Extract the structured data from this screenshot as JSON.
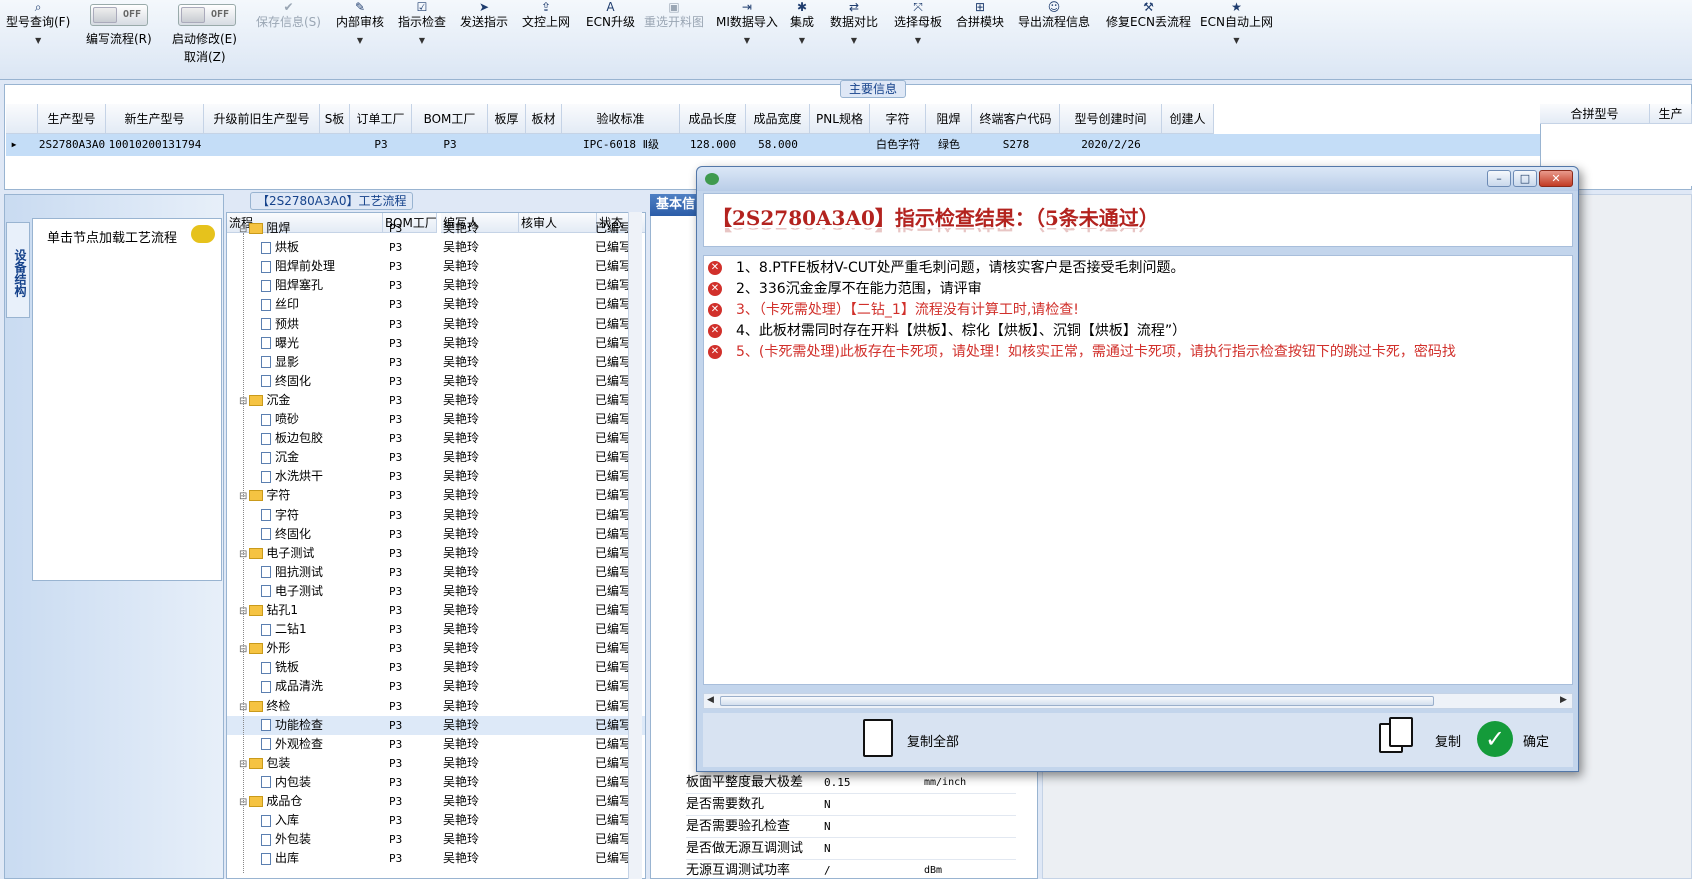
{
  "toolbar": {
    "items": [
      {
        "icon": "search-icon",
        "glyph": "⌕",
        "label": "型号查询(F)",
        "disabled": false,
        "dropdown": true
      },
      {
        "icon": "save-icon",
        "glyph": "✔",
        "label": "保存信息(S)",
        "disabled": true,
        "dropdown": false
      },
      {
        "icon": "review-icon",
        "glyph": "✎",
        "label": "内部审核",
        "disabled": false,
        "dropdown": true
      },
      {
        "icon": "check-icon",
        "glyph": "☑",
        "label": "指示检查",
        "disabled": false,
        "dropdown": true
      },
      {
        "icon": "send-icon",
        "glyph": "➤",
        "label": "发送指示",
        "disabled": false,
        "dropdown": false
      },
      {
        "icon": "upload-icon",
        "glyph": "⇪",
        "label": "文控上网",
        "disabled": false,
        "dropdown": false
      },
      {
        "icon": "ecn-upgrade-icon",
        "glyph": "A",
        "label": "ECN升级",
        "disabled": false,
        "dropdown": false
      },
      {
        "icon": "image-icon",
        "glyph": "▣",
        "label": "重选开料图",
        "disabled": true,
        "dropdown": false
      },
      {
        "icon": "import-icon",
        "glyph": "⇥",
        "label": "MI数据导入",
        "disabled": false,
        "dropdown": true
      },
      {
        "icon": "integrate-icon",
        "glyph": "✱",
        "label": "集成",
        "disabled": false,
        "dropdown": true
      },
      {
        "icon": "compare-icon",
        "glyph": "⇄",
        "label": "数据对比",
        "disabled": false,
        "dropdown": true
      },
      {
        "icon": "mother-board-icon",
        "glyph": "⤧",
        "label": "选择母板",
        "disabled": false,
        "dropdown": true
      },
      {
        "icon": "merge-icon",
        "glyph": "⊞",
        "label": "合拼模块",
        "disabled": false,
        "dropdown": false
      },
      {
        "icon": "export-icon",
        "glyph": "☺",
        "label": "导出流程信息",
        "disabled": false,
        "dropdown": false
      },
      {
        "icon": "repair-icon",
        "glyph": "⚒",
        "label": "修复ECN丢流程",
        "disabled": false,
        "dropdown": false
      },
      {
        "icon": "star-icon",
        "glyph": "★",
        "label": "ECN自动上网",
        "disabled": false,
        "dropdown": true
      }
    ],
    "toggle_off": "OFF",
    "write_flow_label": "编写流程(R)",
    "start_edit_label": "启动修改(E)",
    "cancel_label": "取消(Z)"
  },
  "main_info": {
    "title": "主要信息",
    "columns": [
      "生产型号",
      "新生产型号",
      "升级前旧生产型号",
      "S板",
      "订单工厂",
      "BOM工厂",
      "板厚",
      "板材",
      "验收标准",
      "成品长度",
      "成品宽度",
      "PNL规格",
      "字符",
      "阻焊",
      "终端客户代码",
      "型号创建时间",
      "创建人"
    ],
    "row": [
      "2S2780A3A0",
      "10010200131794",
      "",
      "",
      "P3",
      "P3",
      "",
      "",
      "IPC-6018 Ⅱ级",
      "128.000",
      "58.000",
      "",
      "白色字符",
      "绿色",
      "S278",
      "2020/2/26",
      ""
    ],
    "merge_columns": [
      "合拼型号",
      "生产"
    ]
  },
  "left_panel": {
    "tab": "设备结构",
    "hint": "单击节点加载工艺流程"
  },
  "process": {
    "title": "【2S2780A3A0】工艺流程",
    "columns": [
      "流程",
      "BOM工厂",
      "编写人",
      "核审人",
      "状态"
    ],
    "rows": [
      {
        "name": "阻焊",
        "folder": true,
        "level": 0,
        "bom": "P3",
        "writer": "吴艳玲",
        "status": "已编写"
      },
      {
        "name": "烘板",
        "folder": false,
        "level": 1,
        "bom": "P3",
        "writer": "吴艳玲",
        "status": "已编写"
      },
      {
        "name": "阻焊前处理",
        "folder": false,
        "level": 1,
        "bom": "P3",
        "writer": "吴艳玲",
        "status": "已编写"
      },
      {
        "name": "阻焊塞孔",
        "folder": false,
        "level": 1,
        "bom": "P3",
        "writer": "吴艳玲",
        "status": "已编写"
      },
      {
        "name": "丝印",
        "folder": false,
        "level": 1,
        "bom": "P3",
        "writer": "吴艳玲",
        "status": "已编写"
      },
      {
        "name": "预烘",
        "folder": false,
        "level": 1,
        "bom": "P3",
        "writer": "吴艳玲",
        "status": "已编写"
      },
      {
        "name": "曝光",
        "folder": false,
        "level": 1,
        "bom": "P3",
        "writer": "吴艳玲",
        "status": "已编写"
      },
      {
        "name": "显影",
        "folder": false,
        "level": 1,
        "bom": "P3",
        "writer": "吴艳玲",
        "status": "已编写"
      },
      {
        "name": "终固化",
        "folder": false,
        "level": 1,
        "bom": "P3",
        "writer": "吴艳玲",
        "status": "已编写"
      },
      {
        "name": "沉金",
        "folder": true,
        "level": 0,
        "bom": "P3",
        "writer": "吴艳玲",
        "status": "已编写"
      },
      {
        "name": "喷砂",
        "folder": false,
        "level": 1,
        "bom": "P3",
        "writer": "吴艳玲",
        "status": "已编写"
      },
      {
        "name": "板边包胶",
        "folder": false,
        "level": 1,
        "bom": "P3",
        "writer": "吴艳玲",
        "status": "已编写"
      },
      {
        "name": "沉金",
        "folder": false,
        "level": 1,
        "bom": "P3",
        "writer": "吴艳玲",
        "status": "已编写"
      },
      {
        "name": "水洗烘干",
        "folder": false,
        "level": 1,
        "bom": "P3",
        "writer": "吴艳玲",
        "status": "已编写"
      },
      {
        "name": "字符",
        "folder": true,
        "level": 0,
        "bom": "P3",
        "writer": "吴艳玲",
        "status": "已编写"
      },
      {
        "name": "字符",
        "folder": false,
        "level": 1,
        "bom": "P3",
        "writer": "吴艳玲",
        "status": "已编写"
      },
      {
        "name": "终固化",
        "folder": false,
        "level": 1,
        "bom": "P3",
        "writer": "吴艳玲",
        "status": "已编写"
      },
      {
        "name": "电子测试",
        "folder": true,
        "level": 0,
        "bom": "P3",
        "writer": "吴艳玲",
        "status": "已编写"
      },
      {
        "name": "阻抗测试",
        "folder": false,
        "level": 1,
        "bom": "P3",
        "writer": "吴艳玲",
        "status": "已编写"
      },
      {
        "name": "电子测试",
        "folder": false,
        "level": 1,
        "bom": "P3",
        "writer": "吴艳玲",
        "status": "已编写"
      },
      {
        "name": "钻孔1",
        "folder": true,
        "level": 0,
        "bom": "P3",
        "writer": "吴艳玲",
        "status": "已编写"
      },
      {
        "name": "二钻1",
        "folder": false,
        "level": 1,
        "bom": "P3",
        "writer": "吴艳玲",
        "status": "已编写"
      },
      {
        "name": "外形",
        "folder": true,
        "level": 0,
        "bom": "P3",
        "writer": "吴艳玲",
        "status": "已编写"
      },
      {
        "name": "铣板",
        "folder": false,
        "level": 1,
        "bom": "P3",
        "writer": "吴艳玲",
        "status": "已编写"
      },
      {
        "name": "成品清洗",
        "folder": false,
        "level": 1,
        "bom": "P3",
        "writer": "吴艳玲",
        "status": "已编写"
      },
      {
        "name": "终检",
        "folder": true,
        "level": 0,
        "bom": "P3",
        "writer": "吴艳玲",
        "status": "已编写"
      },
      {
        "name": "功能检查",
        "folder": false,
        "level": 1,
        "bom": "P3",
        "writer": "吴艳玲",
        "status": "已编写",
        "selected": true
      },
      {
        "name": "外观检查",
        "folder": false,
        "level": 1,
        "bom": "P3",
        "writer": "吴艳玲",
        "status": "已编写"
      },
      {
        "name": "包装",
        "folder": true,
        "level": 0,
        "bom": "P3",
        "writer": "吴艳玲",
        "status": "已编写"
      },
      {
        "name": "内包装",
        "folder": false,
        "level": 1,
        "bom": "P3",
        "writer": "吴艳玲",
        "status": "已编写"
      },
      {
        "name": "成品仓",
        "folder": true,
        "level": 0,
        "bom": "P3",
        "writer": "吴艳玲",
        "status": "已编写"
      },
      {
        "name": "入库",
        "folder": false,
        "level": 1,
        "bom": "P3",
        "writer": "吴艳玲",
        "status": "已编写"
      },
      {
        "name": "外包装",
        "folder": false,
        "level": 1,
        "bom": "P3",
        "writer": "吴艳玲",
        "status": "已编写"
      },
      {
        "name": "出库",
        "folder": false,
        "level": 1,
        "bom": "P3",
        "writer": "吴艳玲",
        "status": "已编写"
      }
    ]
  },
  "basic_panel": {
    "tab": "基本信",
    "rows": [
      {
        "key": "板面平整度最大极差",
        "value": "0.15",
        "unit": "mm/inch"
      },
      {
        "key": "是否需要数孔",
        "value": "N",
        "unit": ""
      },
      {
        "key": "是否需要验孔检查",
        "value": "N",
        "unit": ""
      },
      {
        "key": "是否做无源互调测试",
        "value": "N",
        "unit": ""
      },
      {
        "key": "无源互调测试功率",
        "value": "/",
        "unit": "dBm"
      }
    ]
  },
  "dialog": {
    "heading": "【2S2780A3A0】指示检查结果：（5条未通过）",
    "minimize": "–",
    "maximize": "□",
    "close": "✕",
    "issues": [
      {
        "text": "1、8.PTFE板材V-CUT处严重毛刺问题，请核实客户是否接受毛刺问题。",
        "red": false
      },
      {
        "text": "2、336沉金金厚不在能力范围，请评审",
        "red": false
      },
      {
        "text": "3、（卡死需处理）【二钻_1】流程没有计算工时,请检查!",
        "red": true
      },
      {
        "text": "4、此板材需同时存在开料【烘板】、棕化【烘板】、沉铜【烘板】流程”）",
        "red": false
      },
      {
        "text": "5、(卡死需处理)此板存在卡死项，请处理！如核实正常，需通过卡死项，请执行指示检查按钮下的跳过卡死，密码找",
        "red": true
      }
    ],
    "copy_all": "复制全部",
    "copy": "复制",
    "ok": "确定"
  }
}
